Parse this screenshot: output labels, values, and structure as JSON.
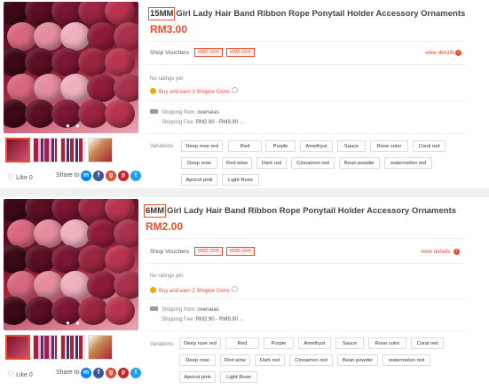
{
  "panels": [
    {
      "size_label": "15MM",
      "title": "Girl Lady Hair Band Ribbon Rope Ponytail Holder Accessory Ornaments",
      "price": "RM3.00",
      "shop_vouchers_label": "Shop Vouchers",
      "vouchers": [
        "RM2 OFF",
        "RM5 OFF"
      ],
      "view_details": "view details",
      "ratings": "No ratings yet",
      "coins": "Buy and earn 3 Shopee Coins",
      "shipping_from_label": "Shipping from:",
      "shipping_from": "overseas",
      "shipping_fee_label": "Shipping Fee:",
      "shipping_fee": "RM2.90 - RM9.90",
      "like": "Like 0",
      "share": "Share to",
      "variations_label": "Variations:",
      "variations": [
        "Deep rose red",
        "Red",
        "Purple",
        "Amethyst",
        "Sauce",
        "Rose color",
        "Coral red",
        "Deep rose",
        "Red wine",
        "Dark red",
        "Cinnamon red",
        "Bean powder",
        "watermelon red",
        "Apricot pink",
        "Light Rose"
      ]
    },
    {
      "size_label": "6MM",
      "title": "Girl Lady Hair Band Ribbon Rope Ponytail Holder Accessory Ornaments",
      "price": "RM2.00",
      "shop_vouchers_label": "Shop Vouchers",
      "vouchers": [
        "RM2 OFF",
        "RM5 OFF"
      ],
      "view_details": "view details",
      "ratings": "No ratings yet",
      "coins": "Buy and earn 2 Shopee Coins",
      "shipping_from_label": "Shipping from:",
      "shipping_from": "overseas",
      "shipping_fee_label": "Shipping Fee:",
      "shipping_fee": "RM2.90 - RM9.90",
      "like": "Like 0",
      "share": "Share to",
      "variations_label": "Variations:",
      "variations": [
        "Deep rose red",
        "Red",
        "Purple",
        "Amethyst",
        "Sauce",
        "Rose color",
        "Coral red",
        "Deep rose",
        "Red wine",
        "Dark red",
        "Cinnamon red",
        "Bean powder",
        "watermelon red",
        "Apricot pink",
        "Light Rose"
      ]
    }
  ],
  "social_icons": [
    "messenger-icon",
    "facebook-icon",
    "google-plus-icon",
    "pinterest-icon",
    "twitter-icon"
  ],
  "colors": {
    "accent": "#ee4d2d",
    "coin": "#f6a700"
  }
}
